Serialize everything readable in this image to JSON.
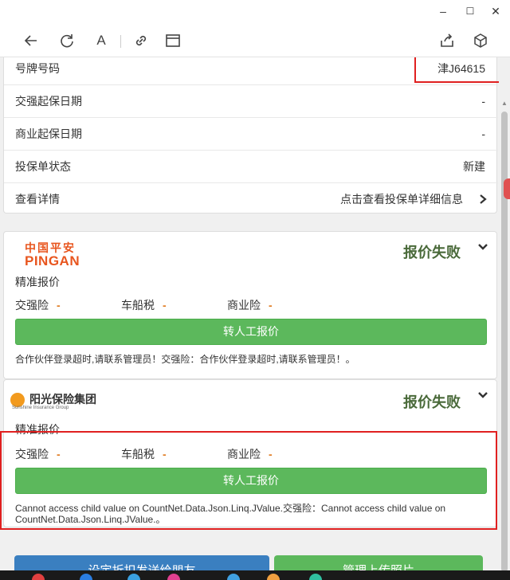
{
  "window": {
    "minimize": "–",
    "maximize": "☐",
    "close": "✕"
  },
  "toolbar": {
    "font_label": "A",
    "icons": [
      "back-icon",
      "refresh-icon",
      "font-icon",
      "link-icon",
      "window-icon",
      "share-icon",
      "cube-icon"
    ]
  },
  "info": {
    "rows": [
      {
        "label": "号牌号码",
        "value": "津J64615"
      },
      {
        "label": "交强起保日期",
        "value": "-"
      },
      {
        "label": "商业起保日期",
        "value": "-"
      },
      {
        "label": "投保单状态",
        "value": "新建"
      },
      {
        "label": "查看详情",
        "value": "点击查看投保单详细信息"
      }
    ]
  },
  "insurers": [
    {
      "logo_cn": "中国平安",
      "logo_en": "PINGAN",
      "status": "报价失败",
      "sub": "精准报价",
      "coverages": [
        {
          "label": "交强险",
          "value": "-"
        },
        {
          "label": "车船税",
          "value": "-"
        },
        {
          "label": "商业险",
          "value": "-"
        }
      ],
      "button": "转人工报价",
      "message": "合作伙伴登录超时,请联系管理员！交强险：合作伙伴登录超时,请联系管理员！。"
    },
    {
      "logo_cn": "阳光保险集团",
      "logo_en": "Sunshine Insurance Group",
      "status": "报价失败",
      "sub": "精准报价",
      "coverages": [
        {
          "label": "交强险",
          "value": "-"
        },
        {
          "label": "车船税",
          "value": "-"
        },
        {
          "label": "商业险",
          "value": "-"
        }
      ],
      "button": "转人工报价",
      "message_line1": "Cannot access child value on CountNet.Data.Json.Linq.JValue.交强险：Cannot access child value on",
      "message_line2": "CountNet.Data.Json.Linq.JValue.。"
    }
  ],
  "bottom": {
    "left_button": "设定折扣发送给朋友",
    "right_button": "管理上传照片"
  },
  "colors": {
    "accent_green": "#5cb85c",
    "status_text": "#4a6a3a",
    "highlight_red": "#e02020",
    "button_blue": "#3a7fc0",
    "pingan_orange": "#e8561f"
  }
}
